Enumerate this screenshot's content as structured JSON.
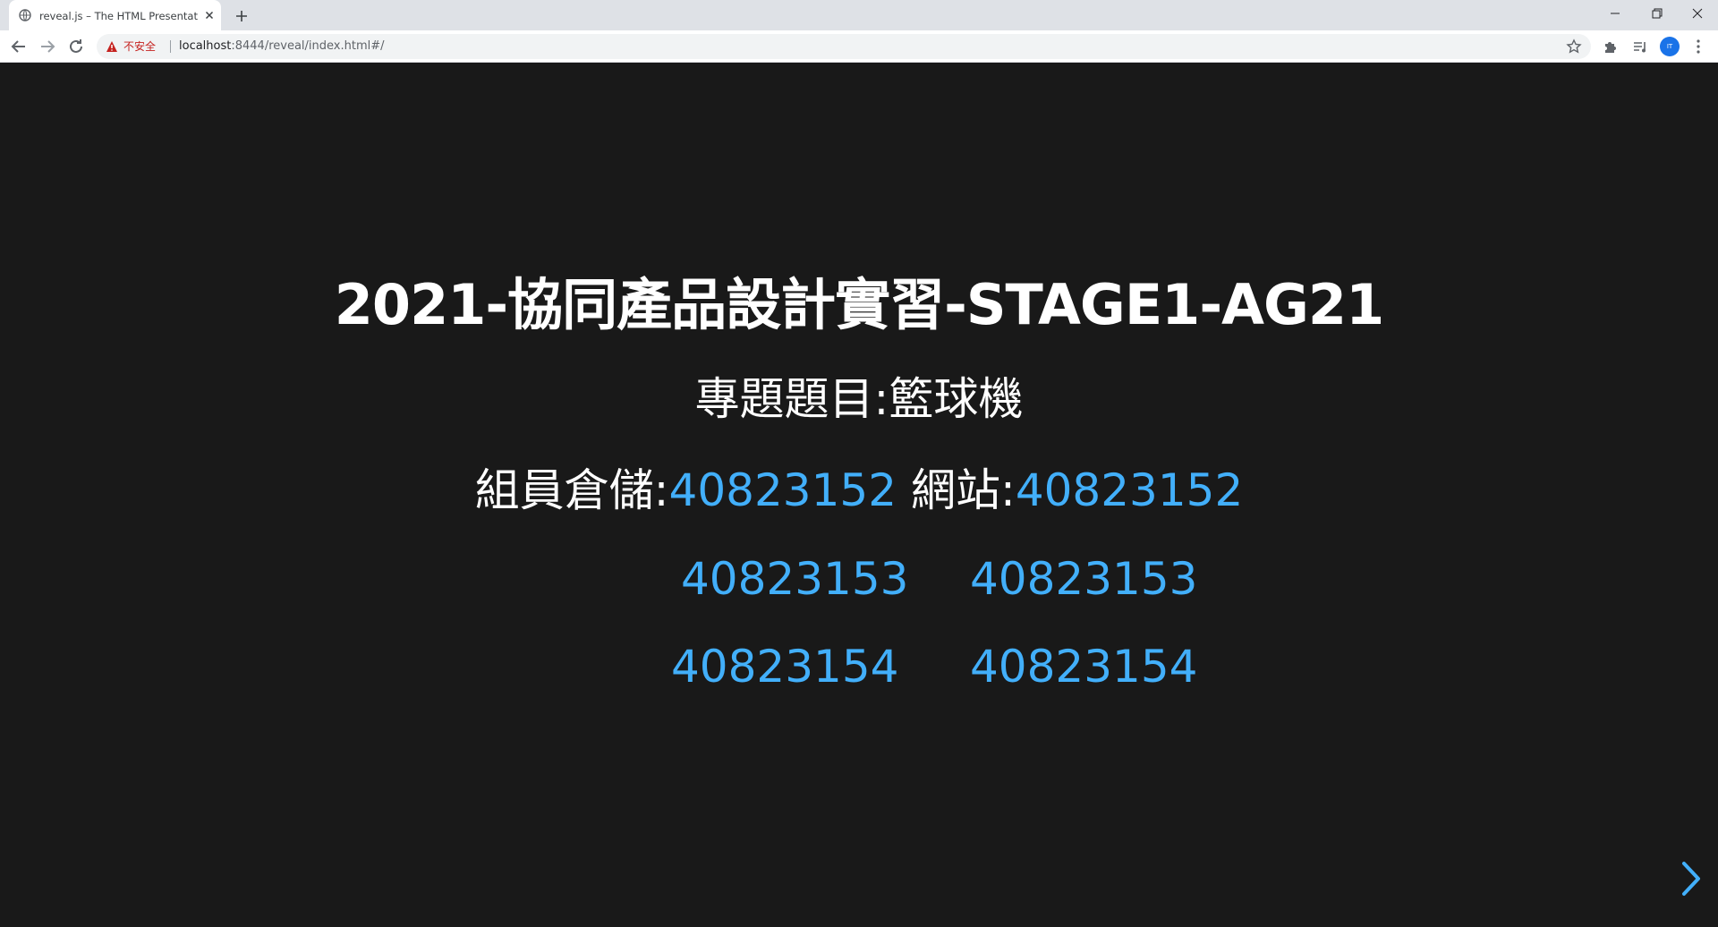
{
  "browser": {
    "tab_title": "reveal.js – The HTML Presentation Framework",
    "security_label": "不安全",
    "url_host": "localhost",
    "url_rest": ":8444/reveal/index.html#/",
    "profile_initials": "IT"
  },
  "slide": {
    "title": "2021-協同產品設計實習-STAGE1-AG21",
    "topic": "專題題目:籃球機",
    "repo_label": "組員倉儲:",
    "site_label": "網站:",
    "members": [
      {
        "repo": "40823152",
        "site": "40823152"
      },
      {
        "repo": "40823153",
        "site": "40823153"
      },
      {
        "repo": "40823154",
        "site": "40823154"
      }
    ]
  },
  "colors": {
    "background": "#191919",
    "link": "#42affa",
    "text": "#ffffff"
  }
}
